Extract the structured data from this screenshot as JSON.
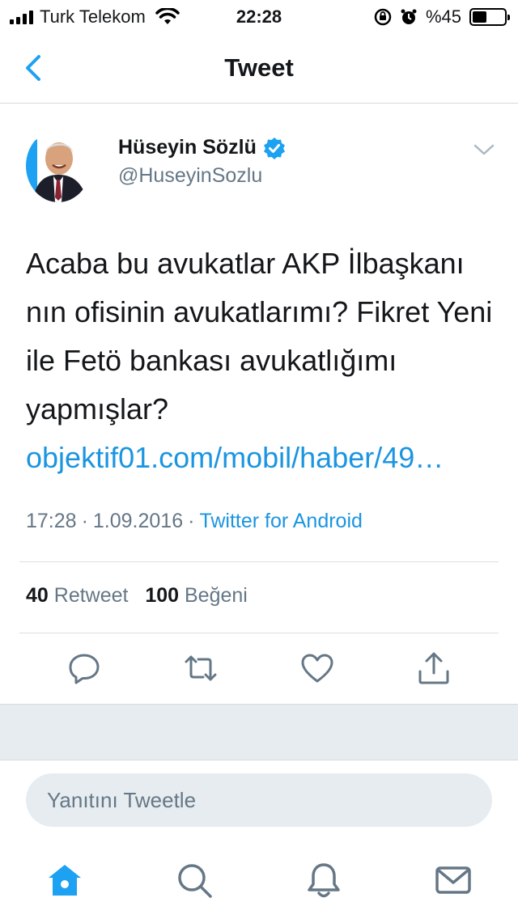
{
  "status_bar": {
    "carrier": "Turk Telekom",
    "time": "22:28",
    "battery": "%45",
    "battery_level": 0.45
  },
  "nav": {
    "title": "Tweet",
    "back_icon": "chevron-left-icon"
  },
  "tweet": {
    "author_name": "Hüseyin Sözlü",
    "author_handle": "@HuseyinSozlu",
    "verified": true,
    "text": "Acaba bu avukatlar AKP İlbaşkanı nın ofisinin avukatlarımı? Fikret Yeni ile Fetö bankası avukatlığımı yapmışlar?",
    "link": "objektif01.com/mobil/haber/49…",
    "time": "17:28",
    "date": "1.09.2016",
    "separator": "·",
    "source": "Twitter for Android",
    "retweet_count": "40",
    "retweet_label": "Retweet",
    "like_count": "100",
    "like_label": "Beğeni"
  },
  "reply": {
    "placeholder": "Yanıtını Tweetle"
  },
  "colors": {
    "accent": "#1b95e0",
    "text": "#14171a",
    "muted": "#657786",
    "divider": "#dcdfe2",
    "band": "#e6ecf0"
  },
  "tabs": [
    "home-icon",
    "search-icon",
    "notifications-icon",
    "messages-icon"
  ]
}
